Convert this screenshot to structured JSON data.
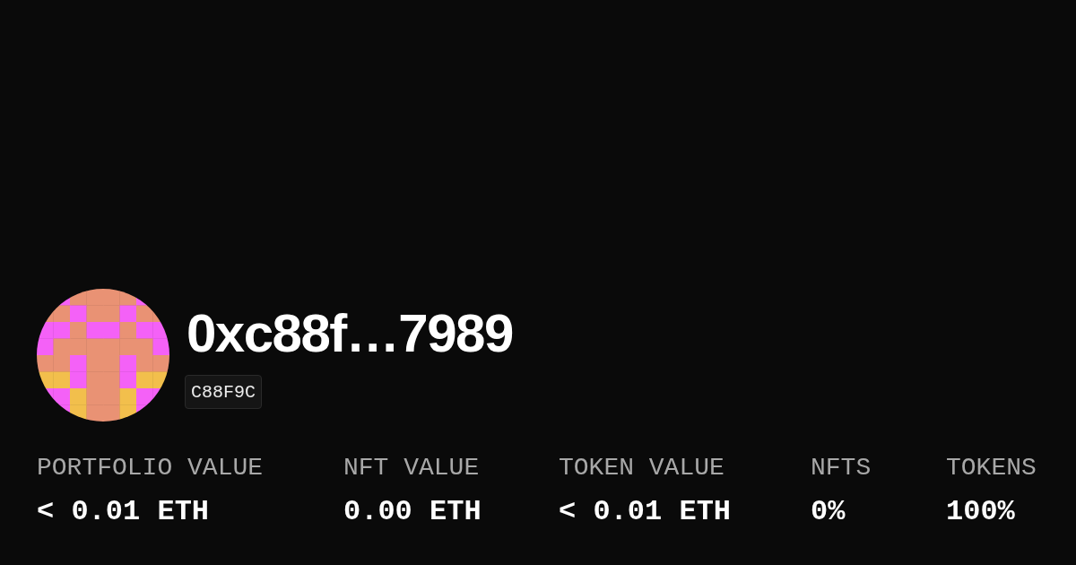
{
  "profile": {
    "name": "0xc88f…7989",
    "tag": "C88F9C"
  },
  "stats": [
    {
      "label": "PORTFOLIO VALUE",
      "value": "< 0.01 ETH"
    },
    {
      "label": "NFT VALUE",
      "value": "0.00 ETH"
    },
    {
      "label": "TOKEN VALUE",
      "value": "< 0.01 ETH"
    },
    {
      "label": "NFTS",
      "value": "0%"
    },
    {
      "label": "TOKENS",
      "value": "100%"
    }
  ]
}
